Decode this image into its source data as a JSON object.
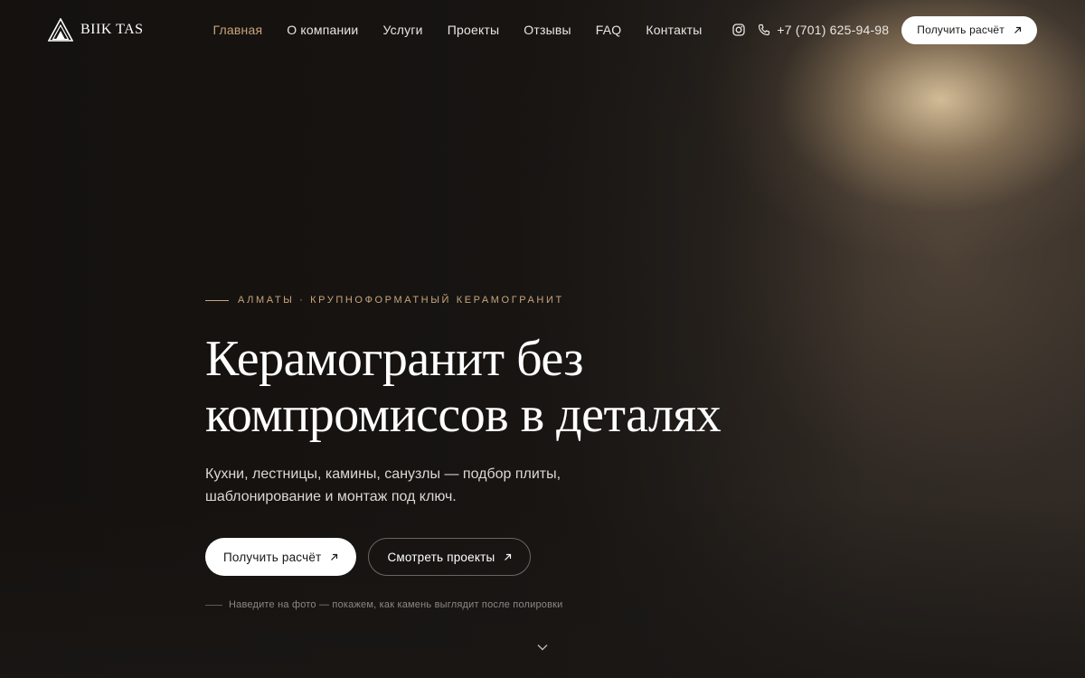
{
  "brand": {
    "name": "BIIK TAS",
    "logo_icon": "triangle-stone-logo"
  },
  "nav": {
    "items": [
      {
        "label": "Главная",
        "active": true
      },
      {
        "label": "О компании"
      },
      {
        "label": "Услуги"
      },
      {
        "label": "Проекты"
      },
      {
        "label": "Отзывы"
      },
      {
        "label": "FAQ"
      },
      {
        "label": "Контакты"
      }
    ]
  },
  "header": {
    "instagram_icon": "instagram-icon",
    "phone": "+7 (701) 625-94-98",
    "cta_label": "Получить расчёт"
  },
  "hero": {
    "eyebrow": "АЛМАТЫ · КРУПНОФОРМАТНЫЙ КЕРАМОГРАНИТ",
    "title_line1": "Керамогранит без",
    "title_line2": "компромиссов в деталях",
    "subtitle": "Кухни, лестницы, камины, санузлы — подбор плиты, шаблонирование и монтаж под ключ.",
    "primary_cta": "Получить расчёт",
    "secondary_cta": "Смотреть проекты",
    "hint": "Наведите на фото — покажем, как камень выглядит после полировки"
  },
  "colors": {
    "accent": "#c8a57b",
    "background": "#1a1715",
    "text": "#ffffff"
  }
}
